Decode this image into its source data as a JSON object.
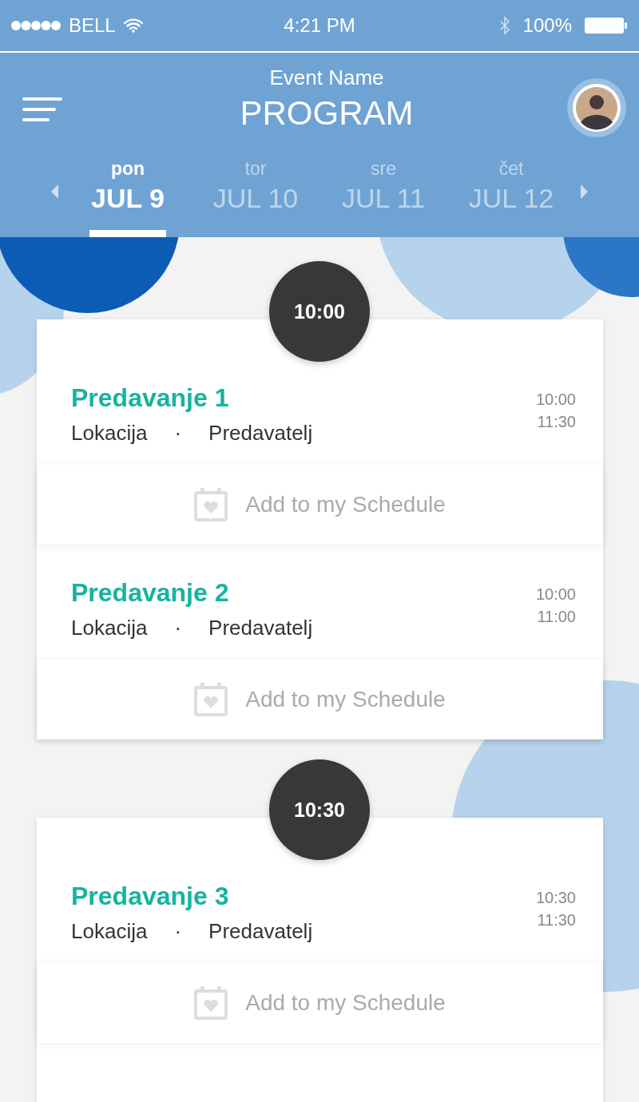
{
  "status_bar": {
    "carrier": "BELL",
    "time": "4:21 PM",
    "battery": "100%"
  },
  "header": {
    "event_name": "Event Name",
    "title": "PROGRAM"
  },
  "days": [
    {
      "weekday": "pon",
      "date": "JUL 9",
      "selected": true
    },
    {
      "weekday": "tor",
      "date": "JUL 10",
      "selected": false
    },
    {
      "weekday": "sre",
      "date": "JUL 11",
      "selected": false
    },
    {
      "weekday": "čet",
      "date": "JUL 12",
      "selected": false
    }
  ],
  "slots": [
    {
      "time": "10:00",
      "sessions": [
        {
          "title": "Predavanje 1",
          "location": "Lokacija",
          "separator": "·",
          "speaker": "Predavatelj",
          "start": "10:00",
          "end": "11:30",
          "action": "Add to my Schedule"
        },
        {
          "title": "Predavanje 2",
          "location": "Lokacija",
          "separator": "·",
          "speaker": "Predavatelj",
          "start": "10:00",
          "end": "11:00",
          "action": "Add to my Schedule"
        }
      ]
    },
    {
      "time": "10:30",
      "sessions": [
        {
          "title": "Predavanje 3",
          "location": "Lokacija",
          "separator": "·",
          "speaker": "Predavatelj",
          "start": "10:30",
          "end": "11:30",
          "action": "Add to my Schedule"
        }
      ]
    }
  ]
}
